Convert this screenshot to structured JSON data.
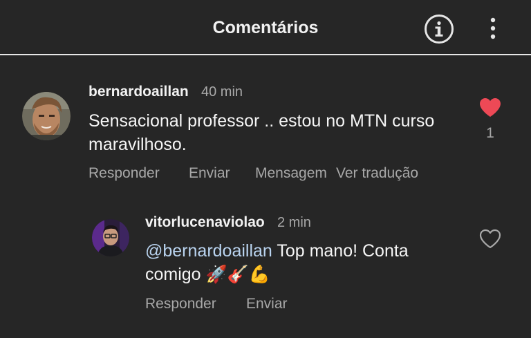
{
  "header": {
    "title": "Comentários",
    "info_icon": "info-icon",
    "more_icon": "more-vertical-icon"
  },
  "comments": [
    {
      "username": "bernardoaillan",
      "time": "40 min",
      "text": "Sensacional  professor .. estou no MTN curso maravilhoso.",
      "like_state": "liked",
      "like_count": "1",
      "actions": {
        "reply": "Responder",
        "send": "Enviar",
        "message": "Mensagem",
        "translate": "Ver tradução"
      },
      "colors": {
        "heart": "#ed4956"
      }
    },
    {
      "username": "vitorlucenaviolao",
      "time": "2 min",
      "mention": "@bernardoaillan",
      "text_line1": " Top mano! Conta",
      "text_line2": "comigo ",
      "emojis": [
        "🚀",
        "🎸",
        "💪"
      ],
      "like_state": "not-liked",
      "actions": {
        "reply": "Responder",
        "send": "Enviar"
      }
    }
  ]
}
